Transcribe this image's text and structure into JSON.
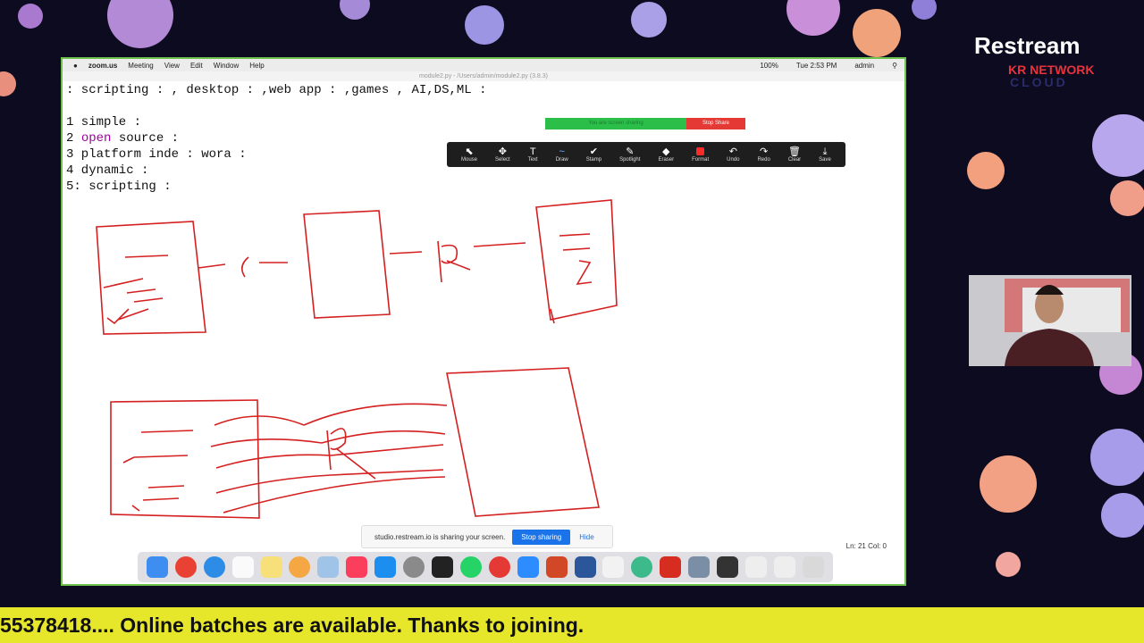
{
  "menubar": {
    "items": [
      "zoom.us",
      "Meeting",
      "View",
      "Edit",
      "Window",
      "Help"
    ],
    "clock": "Tue 2:53 PM",
    "user": "admin",
    "battery": "100%"
  },
  "editor": {
    "title": "module2.py - /Users/admin/module2.py (3.8.3)",
    "lines": [
      ": scripting : , desktop : ,web app : ,games , AI,DS,ML :",
      "",
      "1 simple :",
      "2 |open| source :",
      "3 platform inde : wora :",
      "4 dynamic :",
      "5: scripting :"
    ],
    "status": "Ln: 21   Col: 0"
  },
  "share_bar": {
    "banner": "You are screen sharing",
    "stop": "Stop Share"
  },
  "annotate_toolbar": [
    "Mouse",
    "Select",
    "Text",
    "Draw",
    "Stamp",
    "Spotlight",
    "Eraser",
    "Format",
    "Undo",
    "Redo",
    "Clear",
    "Save"
  ],
  "annotate_glyphs": [
    "⬉",
    "✥",
    "T",
    "~",
    "✔",
    "✎",
    "◆",
    "",
    "↶",
    "↷",
    "🗑",
    "⤓"
  ],
  "share_popup": {
    "message": "studio.restream.io is sharing your screen.",
    "stop": "Stop sharing",
    "hide": "Hide"
  },
  "branding": {
    "name": "Restream",
    "network": "KR NETWORK",
    "sub": "CLOUD"
  },
  "ticker": "55378418.... Online batches are available. Thanks to joining.",
  "colors": {
    "ink": "#d42020",
    "ticker_bg": "#e6e62a",
    "border": "#6cc24a"
  }
}
